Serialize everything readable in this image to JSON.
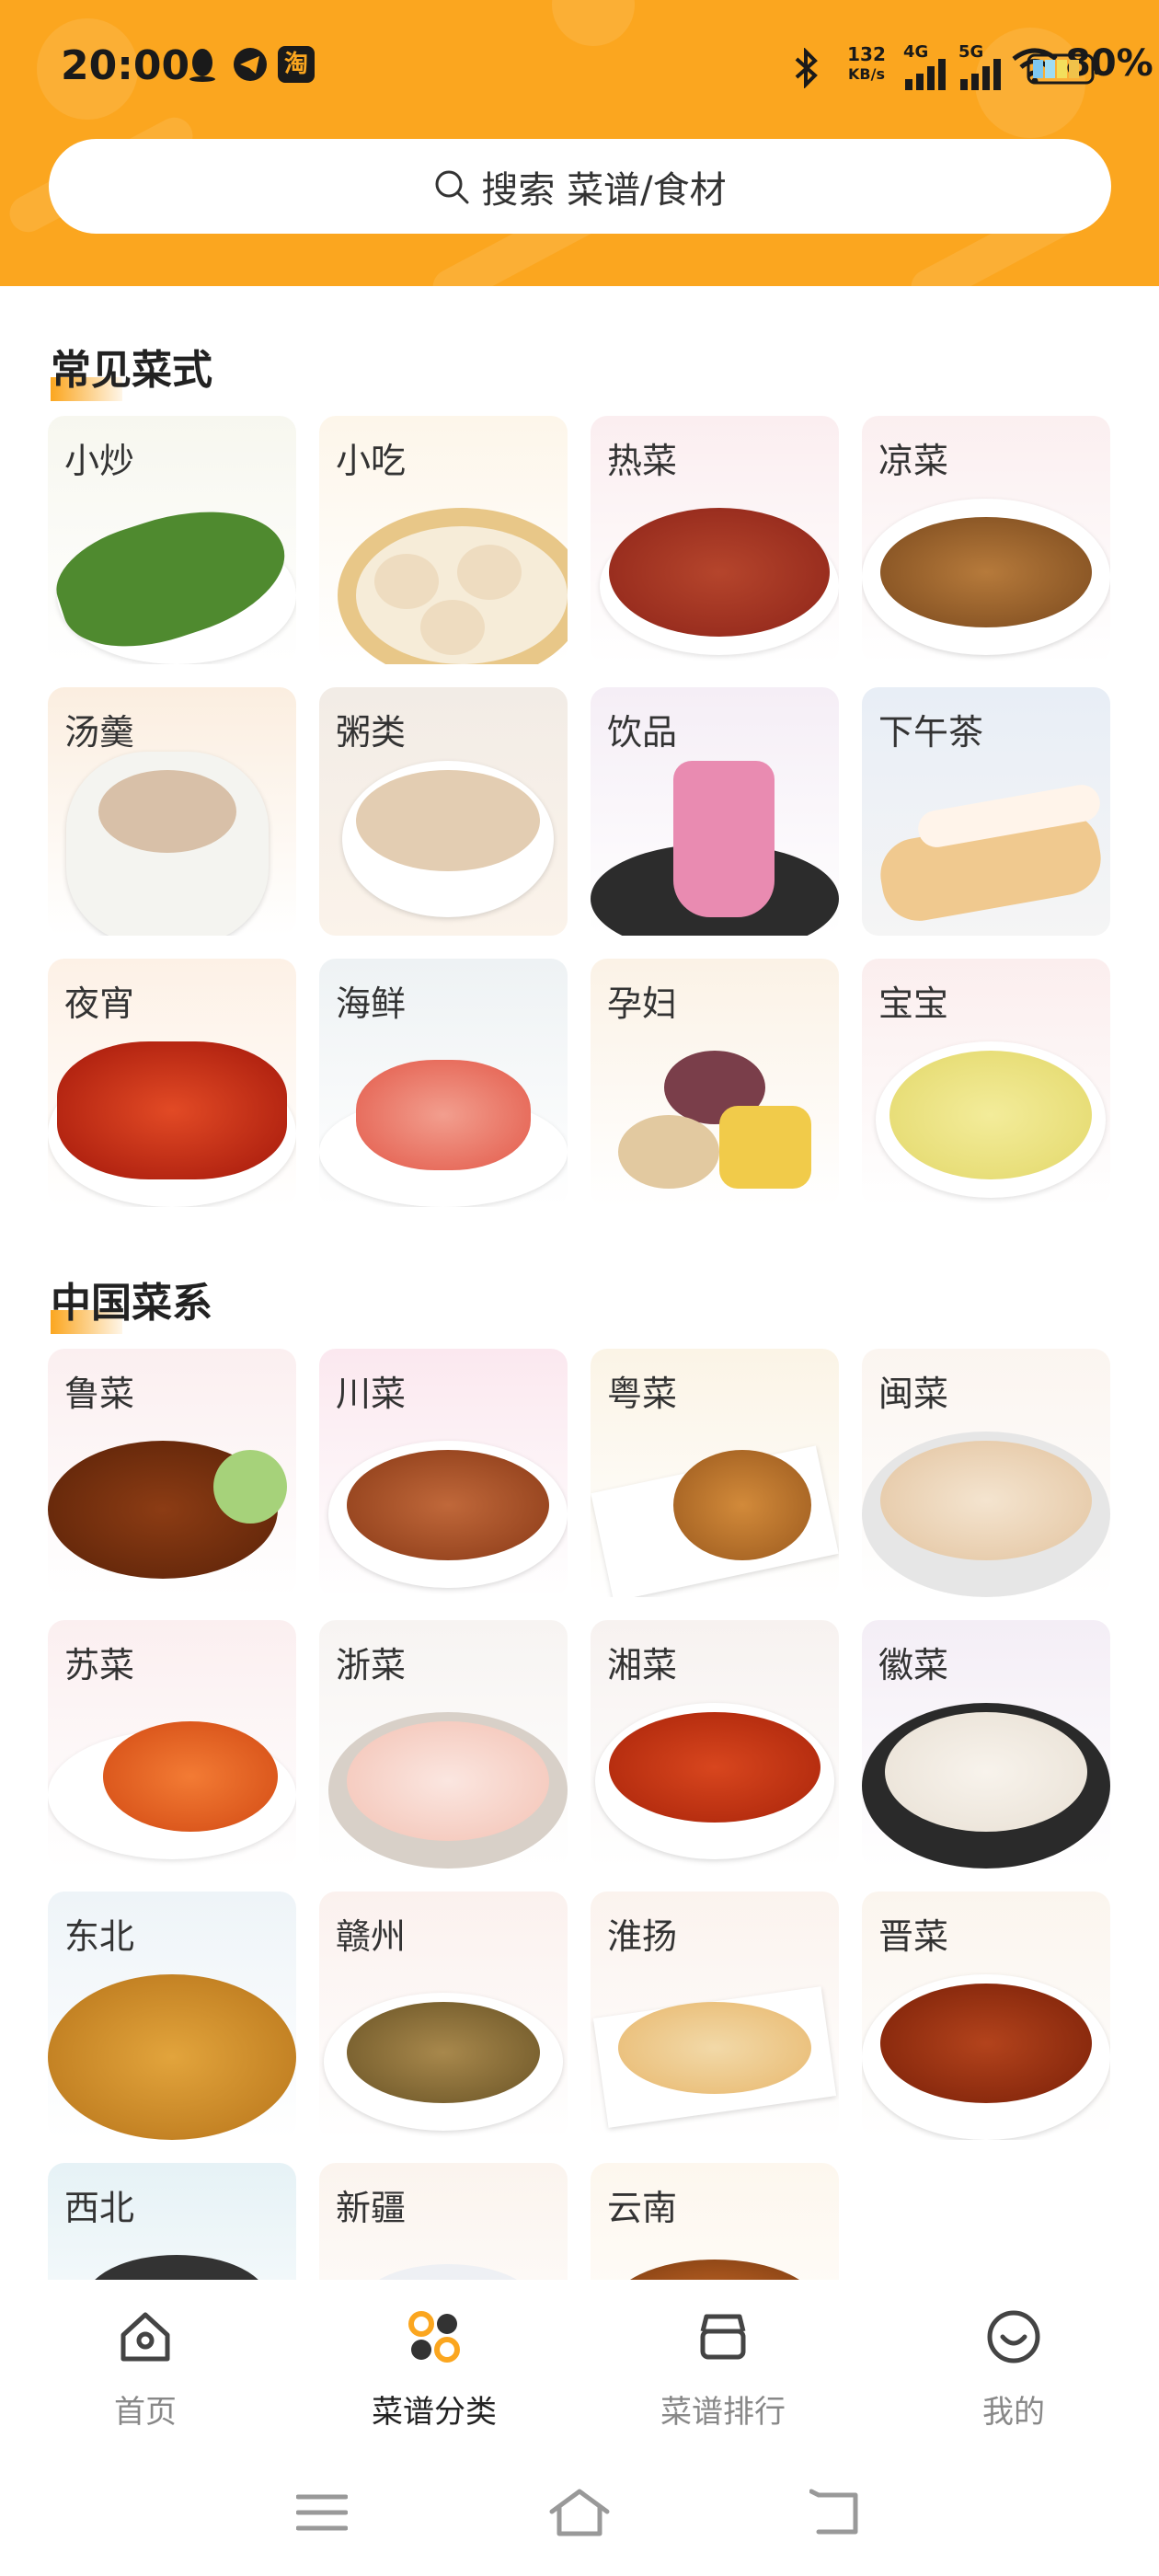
{
  "status": {
    "time": "20:00",
    "net_speed_top": "132",
    "net_speed_bottom": "KB/s",
    "sig1": "4G",
    "sig2": "5G",
    "battery": "80%",
    "notif_app": "淘"
  },
  "search": {
    "placeholder": "搜索 菜谱/食材"
  },
  "sections": [
    {
      "title": "常见菜式",
      "items": [
        "小炒",
        "小吃",
        "热菜",
        "凉菜",
        "汤羹",
        "粥类",
        "饮品",
        "下午茶",
        "夜宵",
        "海鲜",
        "孕妇",
        "宝宝"
      ]
    },
    {
      "title": "中国菜系",
      "items": [
        "鲁菜",
        "川菜",
        "粤菜",
        "闽菜",
        "苏菜",
        "浙菜",
        "湘菜",
        "徽菜",
        "东北",
        "赣州",
        "淮扬",
        "晋菜",
        "西北",
        "新疆",
        "云南"
      ]
    }
  ],
  "tabs": [
    {
      "label": "首页",
      "icon": "home-icon"
    },
    {
      "label": "菜谱分类",
      "icon": "category-icon"
    },
    {
      "label": "菜谱排行",
      "icon": "ranking-icon"
    },
    {
      "label": "我的",
      "icon": "profile-icon"
    }
  ],
  "colors": {
    "accent": "#FBA61F",
    "background": "#ffffff"
  }
}
